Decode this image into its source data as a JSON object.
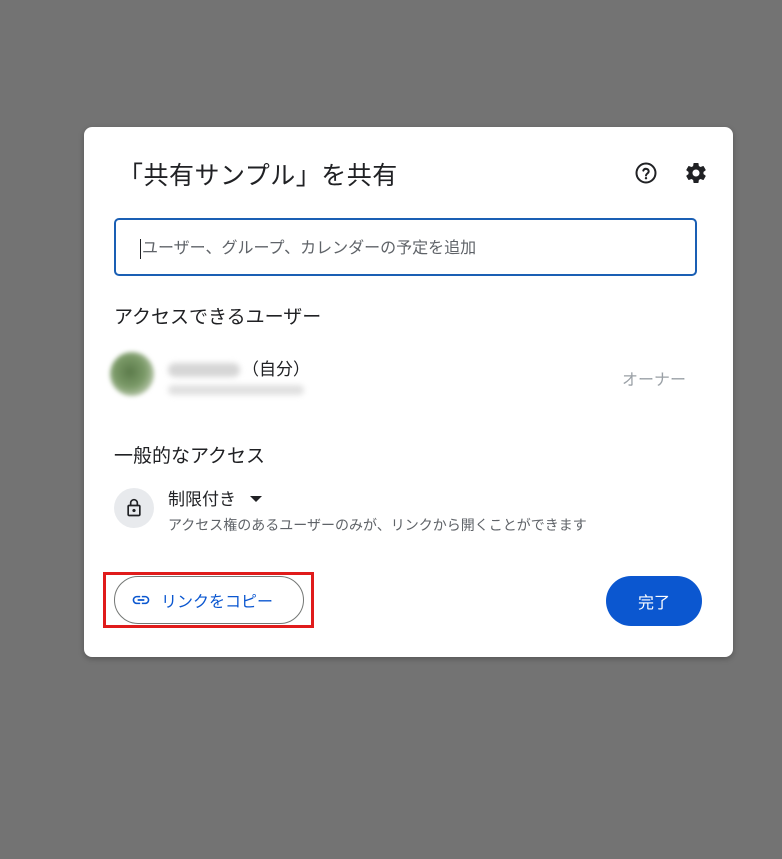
{
  "dialog": {
    "title": "「共有サンプル」を共有",
    "help_icon": "help-circle-icon",
    "settings_icon": "gear-icon"
  },
  "search": {
    "placeholder": "ユーザー、グループ、カレンダーの予定を追加",
    "value": ""
  },
  "people_section": {
    "heading": "アクセスできるユーザー",
    "users": [
      {
        "self_label": "（自分）",
        "role": "オーナー"
      }
    ]
  },
  "general_access": {
    "heading": "一般的なアクセス",
    "icon": "lock-icon",
    "selected_option": "制限付き",
    "description": "アクセス権のあるユーザーのみが、リンクから開くことができます"
  },
  "footer": {
    "copy_link_label": "リンクをコピー",
    "copy_link_icon": "link-icon",
    "done_label": "完了"
  },
  "colors": {
    "accent": "#0b57d0",
    "focus_border": "#1a5fb4",
    "overlay": "#737373",
    "highlight": "#e01b1b"
  }
}
